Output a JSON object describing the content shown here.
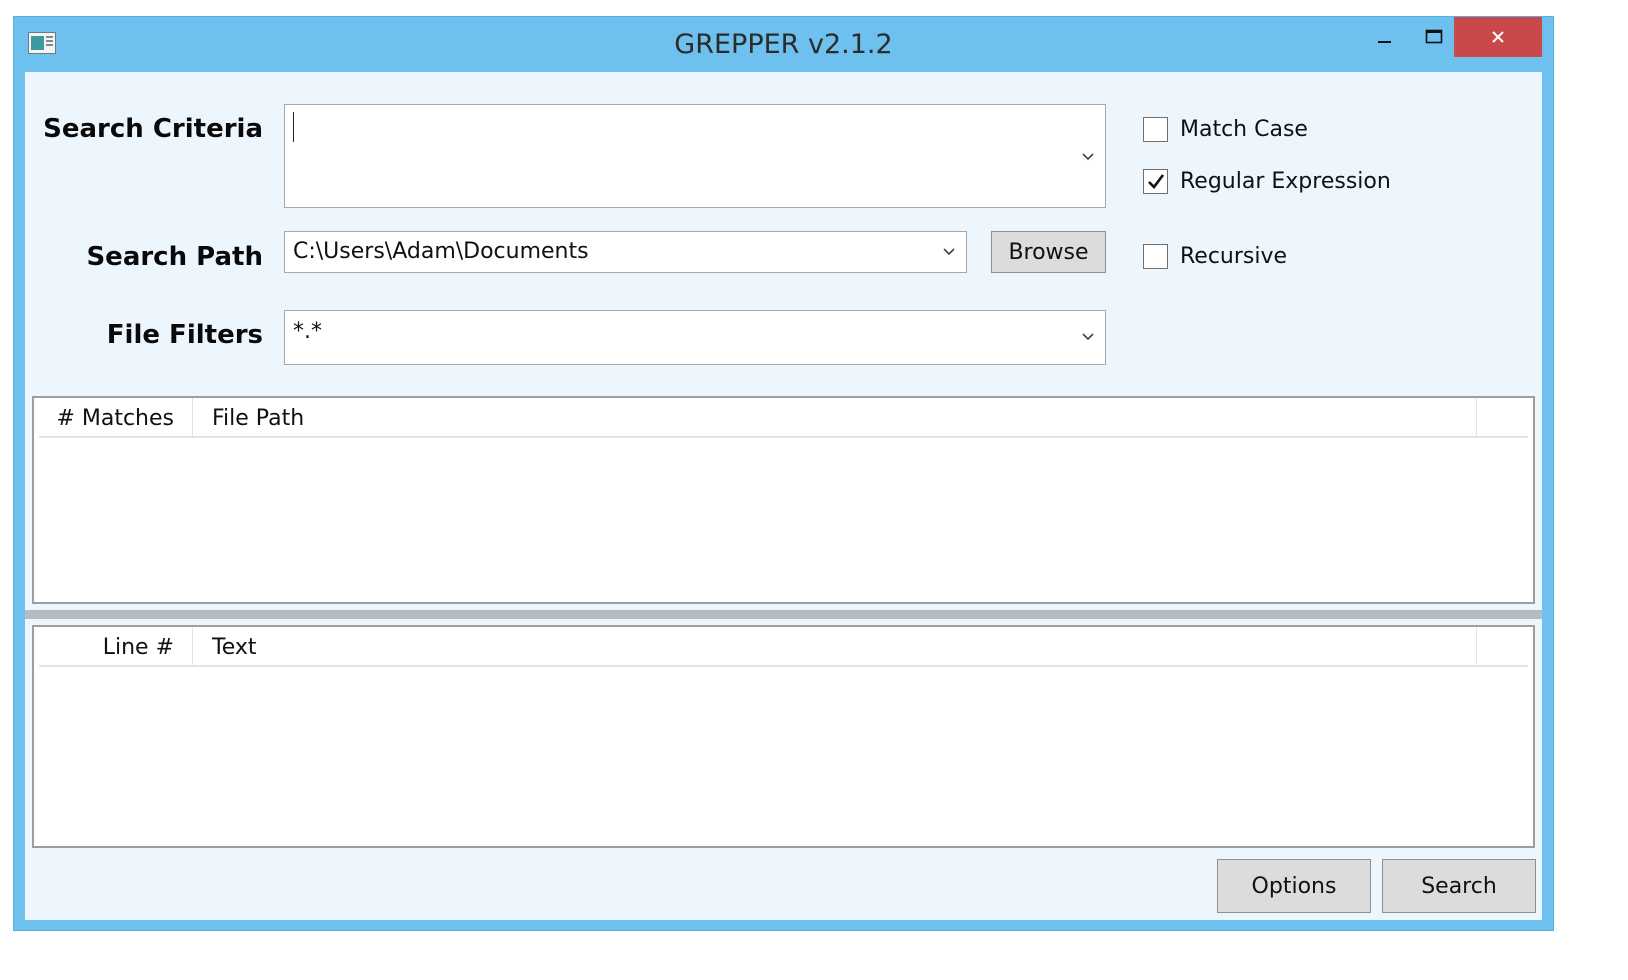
{
  "window": {
    "title": "GREPPER v2.1.2",
    "controls": {
      "minimize": "minimize",
      "maximize": "maximize",
      "close": "close"
    }
  },
  "form": {
    "search_criteria": {
      "label": "Search Criteria",
      "value": ""
    },
    "search_path": {
      "label": "Search Path",
      "value": "C:\\Users\\Adam\\Documents",
      "browse_label": "Browse"
    },
    "file_filters": {
      "label": "File Filters",
      "value": "*.*"
    }
  },
  "options": [
    {
      "label": "Match Case",
      "checked": false
    },
    {
      "label": "Regular Expression",
      "checked": true
    },
    {
      "label": "Recursive",
      "checked": false
    }
  ],
  "results_list": {
    "columns": [
      "# Matches",
      "File Path"
    ],
    "rows": []
  },
  "lines_list": {
    "columns": [
      "Line #",
      "Text"
    ],
    "rows": []
  },
  "footer": {
    "options_label": "Options",
    "search_label": "Search"
  },
  "colors": {
    "title_bar": "#6ec1ee",
    "client_bg": "#eef6fd",
    "close_button": "#c9484a"
  },
  "icons": [
    "app-icon",
    "minimize-icon",
    "maximize-icon",
    "close-icon",
    "chevron-down-icon",
    "checkmark-icon"
  ]
}
